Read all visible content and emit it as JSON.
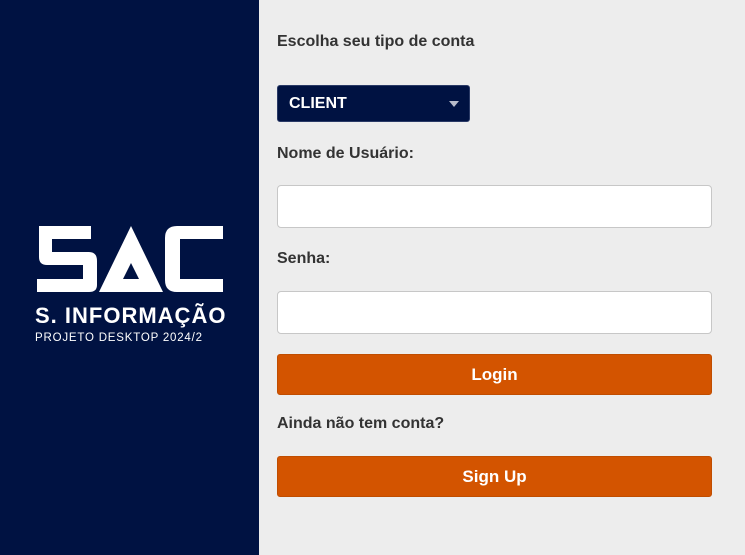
{
  "brand": {
    "logo_text": "SAC",
    "line1": "S. INFORMAÇÃO",
    "line2": "PROJETO DESKTOP 2024/2",
    "panel_color": "#001242"
  },
  "form": {
    "account_type_label": "Escolha seu tipo de conta",
    "account_type_value": "CLIENT",
    "username_label": "Nome de Usuário:",
    "username_value": "",
    "password_label": "Senha:",
    "password_value": "",
    "login_button": "Login",
    "no_account_text": "Ainda não tem conta?",
    "signup_button": "Sign Up",
    "accent_color": "#d35400"
  },
  "icons": {
    "dropdown": "chevron-down-icon"
  }
}
